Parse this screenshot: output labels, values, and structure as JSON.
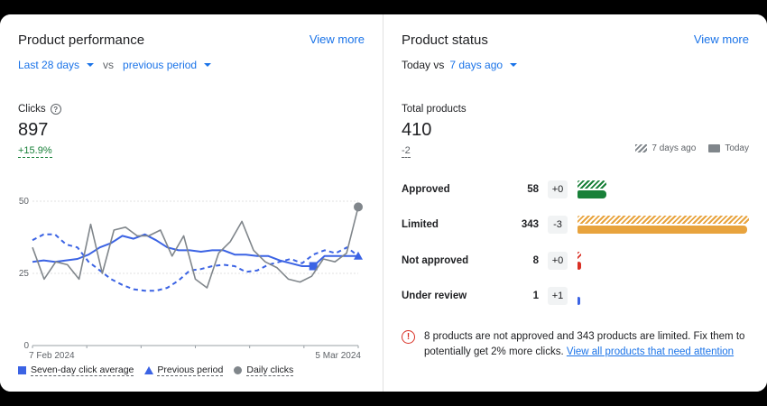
{
  "performance": {
    "title": "Product performance",
    "view_more": "View more",
    "range": "Last 28 days",
    "vs": "vs",
    "compare": "previous period",
    "metric_label": "Clicks",
    "metric_value": "897",
    "metric_change": "+15.9%",
    "legend": {
      "avg": "Seven-day click average",
      "prev": "Previous period",
      "daily": "Daily clicks"
    }
  },
  "chart_data": {
    "type": "line",
    "ylim": [
      0,
      50
    ],
    "y_ticks": [
      "0",
      "25",
      "50"
    ],
    "x_labels": [
      "7 Feb 2024",
      "5 Mar 2024"
    ],
    "series": [
      {
        "name": "Daily clicks",
        "color": "#80868b",
        "values": [
          34,
          23,
          29,
          28,
          23,
          42,
          25,
          40,
          41,
          38,
          38,
          40,
          31,
          38,
          23,
          20,
          32,
          36,
          43,
          33,
          29,
          27,
          23,
          22,
          24,
          30,
          29,
          32,
          48
        ]
      },
      {
        "name": "Seven-day click average",
        "color": "#3b63e4",
        "values": [
          29,
          29.5,
          29,
          29.5,
          30,
          31.5,
          34,
          35.5,
          38,
          37,
          38.5,
          36.5,
          34,
          33,
          33,
          32.5,
          33,
          33,
          31.5,
          31.5,
          31,
          31,
          29.5,
          28.5,
          27.5,
          27.5,
          31,
          31,
          31,
          31
        ]
      },
      {
        "name": "Previous period",
        "color": "#3b63e4",
        "dashed": true,
        "values": [
          36.5,
          38.5,
          38.5,
          35,
          34,
          29,
          26,
          23,
          21,
          19.5,
          19,
          19,
          20,
          22.5,
          26,
          26.5,
          27.5,
          28,
          27.5,
          25.5,
          26,
          28,
          29,
          30,
          28.5,
          31.5,
          33,
          32,
          34,
          31
        ]
      }
    ]
  },
  "status": {
    "title": "Product status",
    "view_more": "View more",
    "today": "Today vs",
    "compare": "7 days ago",
    "metric_label": "Total products",
    "metric_value": "410",
    "metric_change": "-2",
    "legend_prev": "7 days ago",
    "legend_today": "Today",
    "max": 343,
    "rows": [
      {
        "label": "Approved",
        "count": "58",
        "delta": "+0",
        "prev": 58,
        "today": 58,
        "color": "#188038"
      },
      {
        "label": "Limited",
        "count": "343",
        "delta": "-3",
        "prev": 346,
        "today": 343,
        "color": "#e8a33d"
      },
      {
        "label": "Not approved",
        "count": "8",
        "delta": "+0",
        "prev": 8,
        "today": 8,
        "color": "#d93025"
      },
      {
        "label": "Under review",
        "count": "1",
        "delta": "+1",
        "prev": 0,
        "today": 1,
        "color": "#3b63e4"
      }
    ],
    "notice_text": "8 products are not approved and 343 products are limited. Fix them to potentially get 2% more clicks. ",
    "notice_link": "View all products that need attention",
    "alert_glyph": "!"
  }
}
